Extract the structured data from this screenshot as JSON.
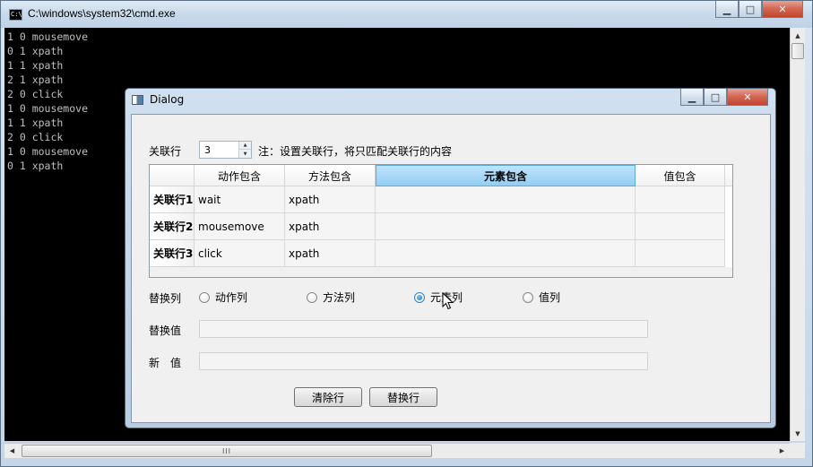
{
  "console_window": {
    "title": "C:\\windows\\system32\\cmd.exe",
    "icon_text": "C:\\",
    "lines": [
      "1 0 mousemove",
      "0 1 xpath",
      "1 1 xpath",
      "2 1 xpath",
      "2 0 click",
      "1 0 mousemove",
      "1 1 xpath",
      "2 0 click",
      "1 0 mousemove",
      "0 1 xpath"
    ],
    "hscroll_thumb_label": "III"
  },
  "dialog": {
    "title": "Dialog",
    "link_row_label": "关联行",
    "link_row_value": "3",
    "link_row_note": "注：设置关联行，将只匹配关联行的内容",
    "table": {
      "columns": [
        "动作包含",
        "方法包含",
        "元素包含",
        "值包含"
      ],
      "active_column_index": 2,
      "rows": [
        {
          "header": "关联行1",
          "cells": [
            "wait",
            "xpath",
            "",
            ""
          ]
        },
        {
          "header": "关联行2",
          "cells": [
            "mousemove",
            "xpath",
            "",
            ""
          ]
        },
        {
          "header": "关联行3",
          "cells": [
            "click",
            "xpath",
            "",
            ""
          ]
        }
      ]
    },
    "replace_column_label": "替换列",
    "radio_options": [
      "动作列",
      "方法列",
      "元素列",
      "值列"
    ],
    "radio_selected_index": 2,
    "replace_value_label": "替换值",
    "replace_value": "",
    "new_value_label": "新　值",
    "new_value": "",
    "buttons": {
      "clear": "清除行",
      "replace": "替换行"
    }
  },
  "colors": {
    "console_bg": "#000000",
    "console_text": "#c0c0c0",
    "active_header": "#93cef3",
    "close_button": "#c2432c"
  }
}
